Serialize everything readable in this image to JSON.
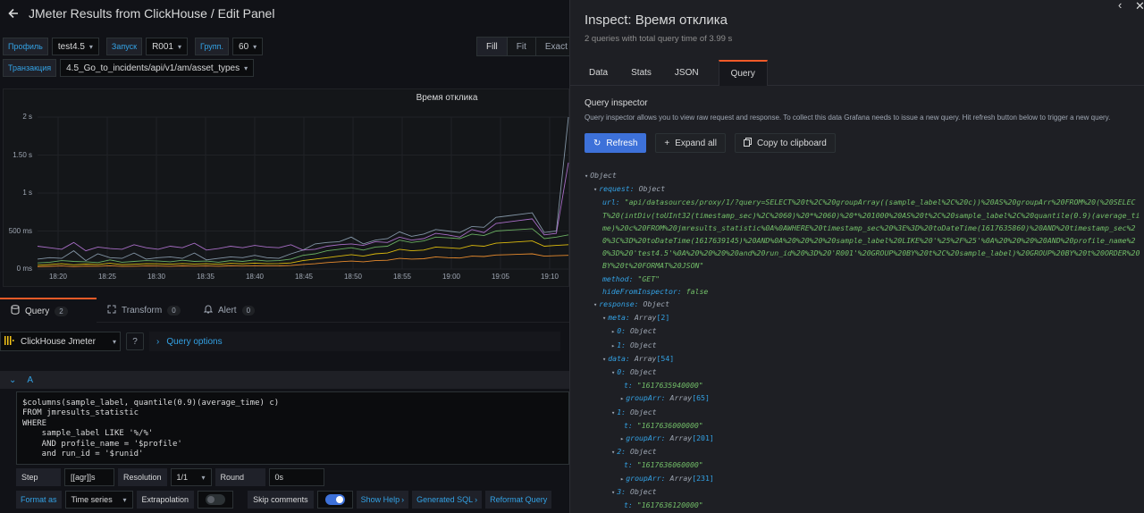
{
  "header": {
    "back_icon": "arrow-left-icon",
    "title": "JMeter Results from ClickHouse / Edit Panel"
  },
  "variables": [
    {
      "label": "Профиль",
      "value": "test4.5"
    },
    {
      "label": "Запуск",
      "value": "R001"
    },
    {
      "label": "Групп.",
      "value": "60"
    },
    {
      "label": "Транзакция",
      "value": "4.5_Go_to_incidents/api/v1/am/asset_types"
    }
  ],
  "fit_buttons": [
    "Fill",
    "Fit",
    "Exact"
  ],
  "panel": {
    "title": "Время отклика"
  },
  "chart_data": {
    "type": "line",
    "title": "Время отклика",
    "y_ticks": [
      "2 s",
      "1.50 s",
      "1 s",
      "500 ms",
      "0 ms"
    ],
    "x_ticks": [
      "18:20",
      "18:25",
      "18:30",
      "18:35",
      "18:40",
      "18:45",
      "18:50",
      "18:55",
      "19:00",
      "19:05",
      "19:10"
    ],
    "ylim_ms": [
      0,
      2000
    ],
    "series": [
      {
        "values": [
          130,
          150,
          140,
          240,
          110,
          200,
          150,
          140,
          210,
          130,
          150,
          160,
          140,
          210,
          120,
          140,
          160,
          150,
          180,
          150,
          140,
          200,
          250,
          330,
          350,
          360,
          420,
          330,
          380,
          400,
          490,
          430,
          460,
          520,
          500,
          480,
          560,
          550,
          680,
          700,
          720,
          740,
          480,
          500,
          2000
        ]
      },
      {
        "values": [
          80,
          90,
          110,
          100,
          95,
          85,
          120,
          90,
          100,
          110,
          105,
          95,
          115,
          100,
          105,
          90,
          110,
          100,
          120,
          105,
          110,
          130,
          180,
          200,
          240,
          260,
          280,
          250,
          290,
          300,
          380,
          350,
          370,
          420,
          410,
          400,
          460,
          440,
          500,
          510,
          520,
          530,
          400,
          420,
          450
        ]
      },
      {
        "values": [
          50,
          60,
          70,
          55,
          65,
          60,
          75,
          58,
          62,
          70,
          68,
          64,
          72,
          66,
          70,
          62,
          74,
          68,
          78,
          70,
          72,
          80,
          110,
          130,
          150,
          170,
          190,
          170,
          200,
          210,
          260,
          240,
          250,
          290,
          280,
          270,
          310,
          300,
          340,
          350,
          360,
          370,
          300,
          310,
          320
        ]
      },
      {
        "values": [
          30,
          35,
          40,
          32,
          38,
          36,
          42,
          34,
          37,
          40,
          39,
          37,
          41,
          38,
          40,
          36,
          42,
          39,
          44,
          40,
          41,
          46,
          60,
          70,
          85,
          95,
          105,
          95,
          110,
          115,
          140,
          130,
          135,
          160,
          150,
          145,
          170,
          165,
          185,
          190,
          195,
          200,
          170,
          175,
          180
        ]
      },
      {
        "values": [
          300,
          280,
          260,
          350,
          240,
          290,
          270,
          260,
          320,
          280,
          260,
          300,
          280,
          340,
          250,
          270,
          300,
          280,
          310,
          290,
          280,
          320,
          250,
          260,
          300,
          320,
          330,
          310,
          360,
          350,
          420,
          380,
          400,
          470,
          450,
          420,
          520,
          480,
          600,
          620,
          640,
          660,
          450,
          470,
          1400
        ]
      }
    ]
  },
  "editor_tabs": [
    {
      "label": "Query",
      "count": "2",
      "icon": "database-icon"
    },
    {
      "label": "Transform",
      "count": "0",
      "icon": "transform-icon"
    },
    {
      "label": "Alert",
      "count": "0",
      "icon": "bell-icon"
    }
  ],
  "datasource": {
    "name": "ClickHouse Jmeter",
    "query_options": "Query options"
  },
  "query_row": {
    "ref": "A"
  },
  "sql": "$columns(sample_label, quantile(0.9)(average_time) c)\nFROM jmresults_statistic\nWHERE\n    sample_label LIKE '%/%'\n    AND profile_name = '$profile'\n    and run_id = '$runid'",
  "options": {
    "step_label": "Step",
    "step_value": "[[agr]]s",
    "resolution_label": "Resolution",
    "resolution_value": "1/1",
    "round_label": "Round",
    "round_value": "0s",
    "format_label": "Format as",
    "format_value": "Time series",
    "extrapolation_label": "Extrapolation",
    "skip_label": "Skip comments",
    "show_help": "Show Help",
    "generated_sql": "Generated SQL",
    "reformat": "Reformat Query"
  },
  "inspect": {
    "title": "Inspect: Время отклика",
    "subtitle": "2 queries with total query time of 3.99 s",
    "tabs": [
      "Data",
      "Stats",
      "JSON",
      "Query"
    ],
    "qi_heading": "Query inspector",
    "qi_desc": "Query inspector allows you to view raw request and response. To collect this data Grafana needs to issue a new query. Hit refresh button below to trigger a new query.",
    "refresh": "Refresh",
    "expand": "Expand all",
    "copy": "Copy to clipboard"
  },
  "tree": {
    "root": "Object",
    "request": "request:",
    "request_type": "Object",
    "url_key": "url:",
    "url_val": "\"api/datasources/proxy/1/?query=SELECT%20t%2C%20groupArray((sample_label%2C%20c))%20AS%20groupArr%20FROM%20(%20SELECT%20(intDiv(toUInt32(timestamp_sec)%2C%2060)%20*%2060)%20*%201000%20AS%20t%2C%20sample_label%2C%20quantile(0.9)(average_time)%20c%20FROM%20jmresults_statistic%0A%0AWHERE%20timestamp_sec%20%3E%3D%20toDateTime(1617635860)%20AND%20timestamp_sec%20%3C%3D%20toDateTime(1617639145)%20AND%0A%20%20%20%20sample_label%20LIKE%20'%25%2F%25'%0A%20%20%20%20AND%20profile_name%20%3D%20'test4.5'%0A%20%20%20%20and%20run_id%20%3D%20'R001'%20GROUP%20BY%20t%2C%20sample_label)%20GROUP%20BY%20t%20ORDER%20BY%20t%20FORMAT%20JSON\"",
    "method_key": "method:",
    "method_val": "\"GET\"",
    "hide_key": "hideFromInspector:",
    "hide_val": "false",
    "response": "response:",
    "response_type": "Object",
    "meta": "meta:",
    "meta_type": "Array",
    "meta_len": "[2]",
    "m0": "0:",
    "m0_type": "Object",
    "m1": "1:",
    "m1_type": "Object",
    "data": "data:",
    "data_type": "Array",
    "data_len": "[54]",
    "items": [
      {
        "idx": "0:",
        "t_key": "t:",
        "t_val": "\"1617635940000\"",
        "arr_key": "groupArr:",
        "arr_len": "[65]"
      },
      {
        "idx": "1:",
        "t_key": "t:",
        "t_val": "\"1617636000000\"",
        "arr_key": "groupArr:",
        "arr_len": "[201]"
      },
      {
        "idx": "2:",
        "t_key": "t:",
        "t_val": "\"1617636060000\"",
        "arr_key": "groupArr:",
        "arr_len": "[231]"
      },
      {
        "idx": "3:",
        "t_key": "t:",
        "t_val": "\"1617636120000\""
      }
    ],
    "obj": "Object",
    "arr": "Array"
  }
}
